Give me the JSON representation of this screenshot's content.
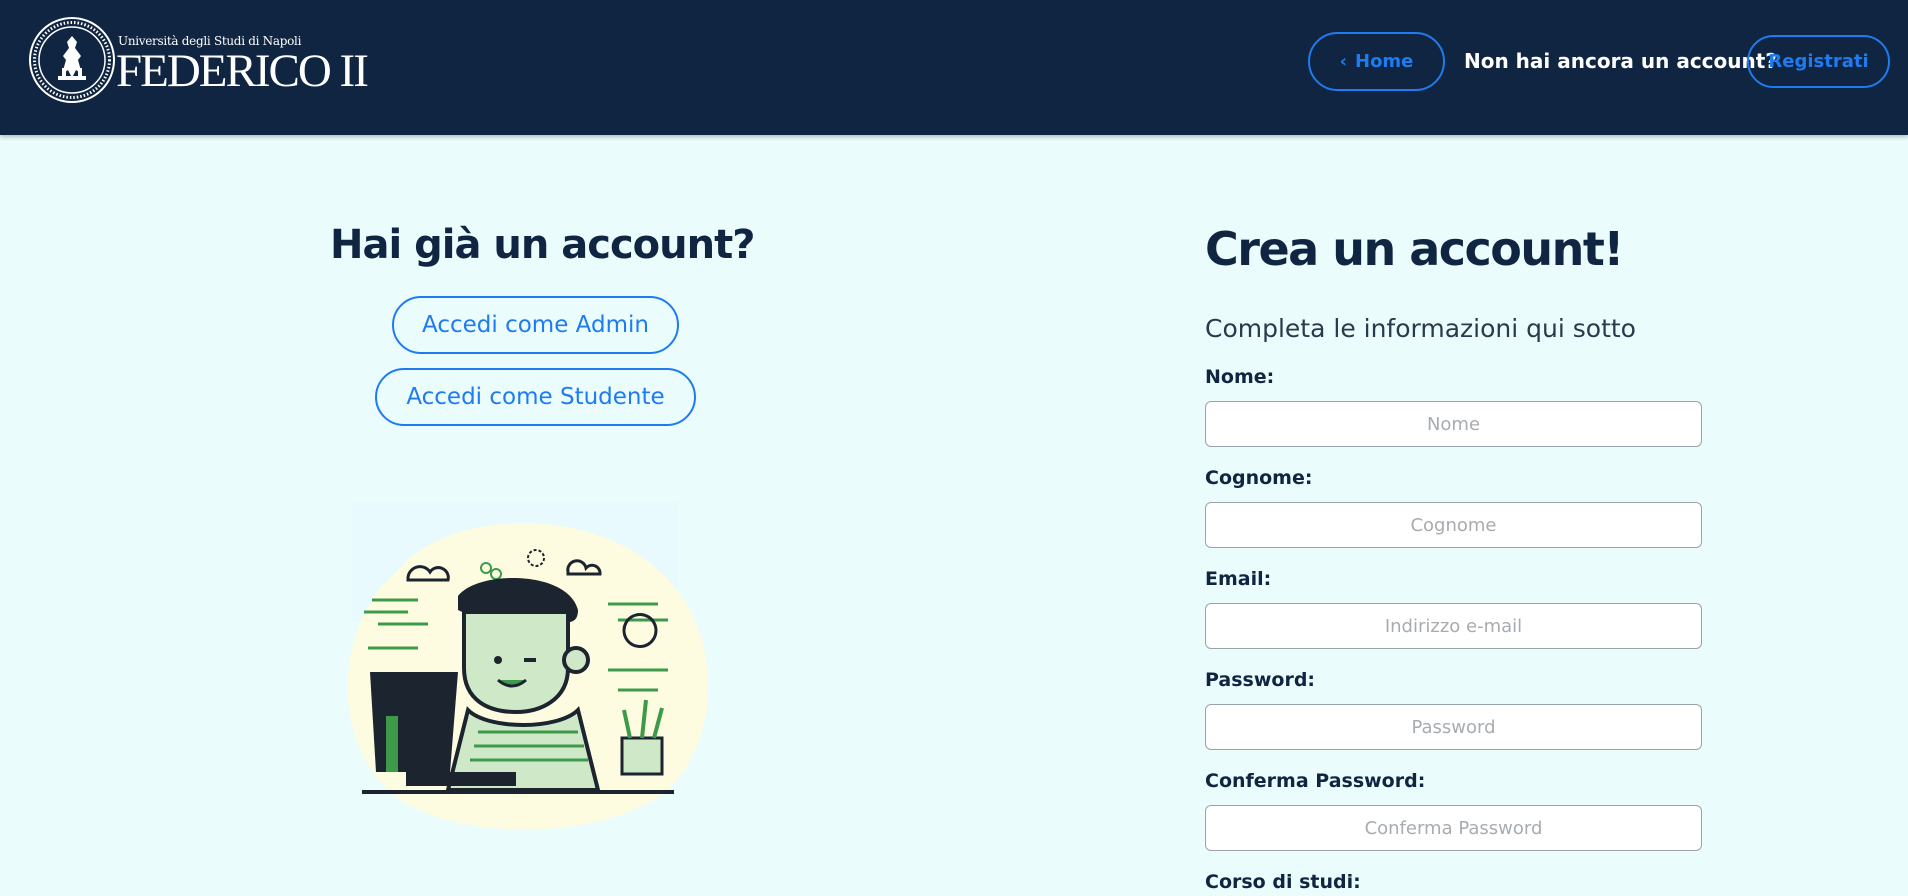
{
  "header": {
    "logo_top": "Università degli Studi di Napoli",
    "logo_main": "FEDERICO II",
    "home_button": "Home",
    "no_account_text": "Non hai ancora un account?",
    "register_button": "Registrati"
  },
  "login": {
    "title": "Hai già un account?",
    "admin_button": "Accedi come Admin",
    "student_button": "Accedi come Studente"
  },
  "register": {
    "title": "Crea un account!",
    "subtitle": "Completa le informazioni qui sotto",
    "fields": [
      {
        "label": "Nome:",
        "placeholder": "Nome"
      },
      {
        "label": "Cognome:",
        "placeholder": "Cognome"
      },
      {
        "label": "Email:",
        "placeholder": "Indirizzo e-mail"
      },
      {
        "label": "Password:",
        "placeholder": "Password"
      },
      {
        "label": "Conferma Password:",
        "placeholder": "Conferma Password"
      },
      {
        "label": "Corso di studi:"
      }
    ]
  },
  "colors": {
    "header_bg": "#102542",
    "page_bg": "#ebfcfc",
    "accent": "#1e7bf0"
  }
}
